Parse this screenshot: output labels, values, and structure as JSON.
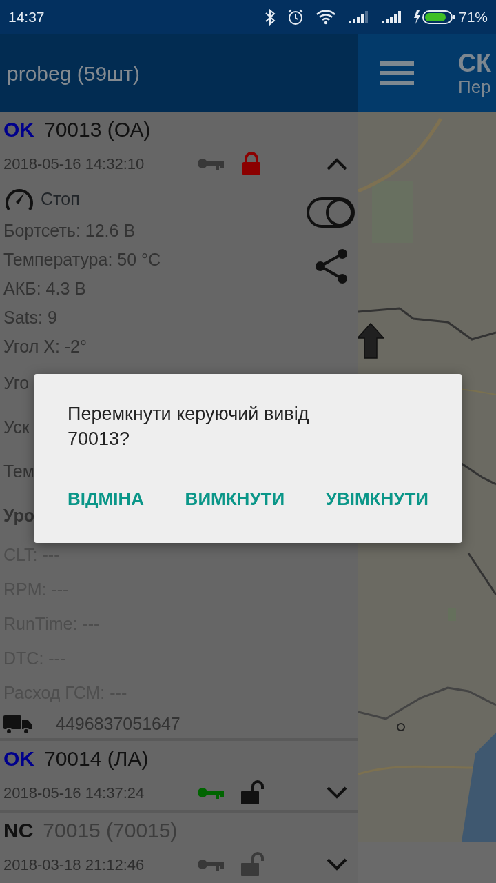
{
  "status_bar": {
    "time": "14:37",
    "battery": "71%"
  },
  "app_bar": {
    "title": "probeg (59шт)"
  },
  "right_pane": {
    "title": "СК",
    "subtitle": "Пер"
  },
  "units": [
    {
      "status": "OK",
      "color": "#00008b",
      "name": "70013 (ОА)",
      "online": true,
      "time": "2018-05-16 14:32:10",
      "ignition": false,
      "locked": true,
      "expanded": true,
      "motion": "Стоп",
      "toggle_on": false,
      "details": [
        {
          "text": "Бортсеть: 12.6 В",
          "kind": "normal"
        },
        {
          "text": "Температура: 50 °C",
          "kind": "normal"
        },
        {
          "text": "АКБ: 4.3 В",
          "kind": "normal"
        },
        {
          "text": "Sats: 9",
          "kind": "normal"
        },
        {
          "text": "Угол X: -2°",
          "kind": "normal"
        },
        {
          "text": "Уго",
          "kind": "normal"
        },
        {
          "text": "Уск",
          "kind": "normal"
        },
        {
          "text": "Тем",
          "kind": "normal"
        },
        {
          "text": "Уро",
          "kind": "bold"
        },
        {
          "text": "CLT: ---",
          "kind": "muted"
        },
        {
          "text": "RPM: ---",
          "kind": "muted"
        },
        {
          "text": "RunTime: ---",
          "kind": "muted"
        },
        {
          "text": "DTC: ---",
          "kind": "muted"
        },
        {
          "text": "Расход ГСМ: ---",
          "kind": "muted"
        }
      ],
      "phone": "4496837051647"
    },
    {
      "status": "OK",
      "color": "#00008b",
      "name": "70014 (ЛА)",
      "online": true,
      "time": "2018-05-16 14:37:24",
      "ignition": true,
      "locked": false,
      "expanded": false
    },
    {
      "status": "NC",
      "color": "#111111",
      "name": "70015 (70015)",
      "online": false,
      "time": "2018-03-18 21:12:46",
      "ignition": false,
      "locked": false,
      "expanded": false
    }
  ],
  "dialog": {
    "message": "Перемкнути керуючий вивід 70013?",
    "buttons": [
      "ВІДМІНА",
      "ВИМКНУТИ",
      "УВІМКНУТИ"
    ]
  }
}
